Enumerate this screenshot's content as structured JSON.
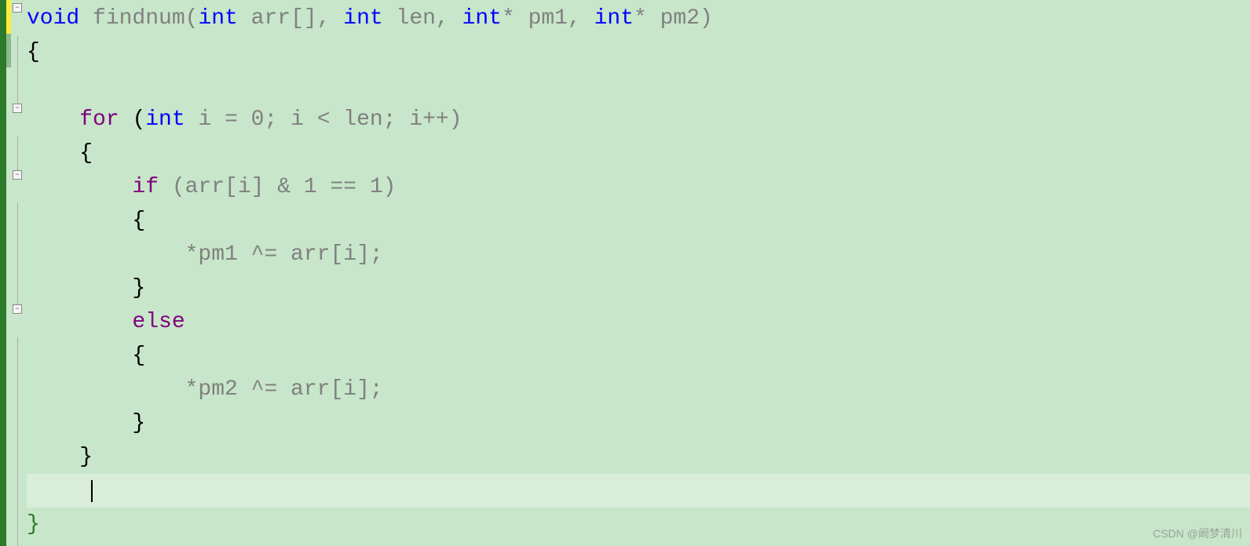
{
  "code": {
    "line1": {
      "void": "void",
      "fname": " findnum(",
      "int1": "int",
      "arr": " arr[], ",
      "int2": "int",
      "len": " len, ",
      "int3": "int",
      "pm1": "* pm1, ",
      "int4": "int",
      "pm2": "* pm2)"
    },
    "line2": "{",
    "line3": "",
    "line4": {
      "indent": "    ",
      "for": "for",
      "open": " (",
      "int": "int",
      "rest": " i = 0; i < len; i++)"
    },
    "line5": "    {",
    "line6": {
      "indent": "        ",
      "if": "if",
      "rest": " (arr[i] & 1 == 1)"
    },
    "line7": "        {",
    "line8": "            *pm1 ^= arr[i];",
    "line9": "        }",
    "line10": {
      "indent": "        ",
      "else": "else"
    },
    "line11": "        {",
    "line12": "            *pm2 ^= arr[i];",
    "line13": "        }",
    "line14": "    }",
    "line15": "    ",
    "line16": "}"
  },
  "watermark": "CSDN @阚梦清川"
}
